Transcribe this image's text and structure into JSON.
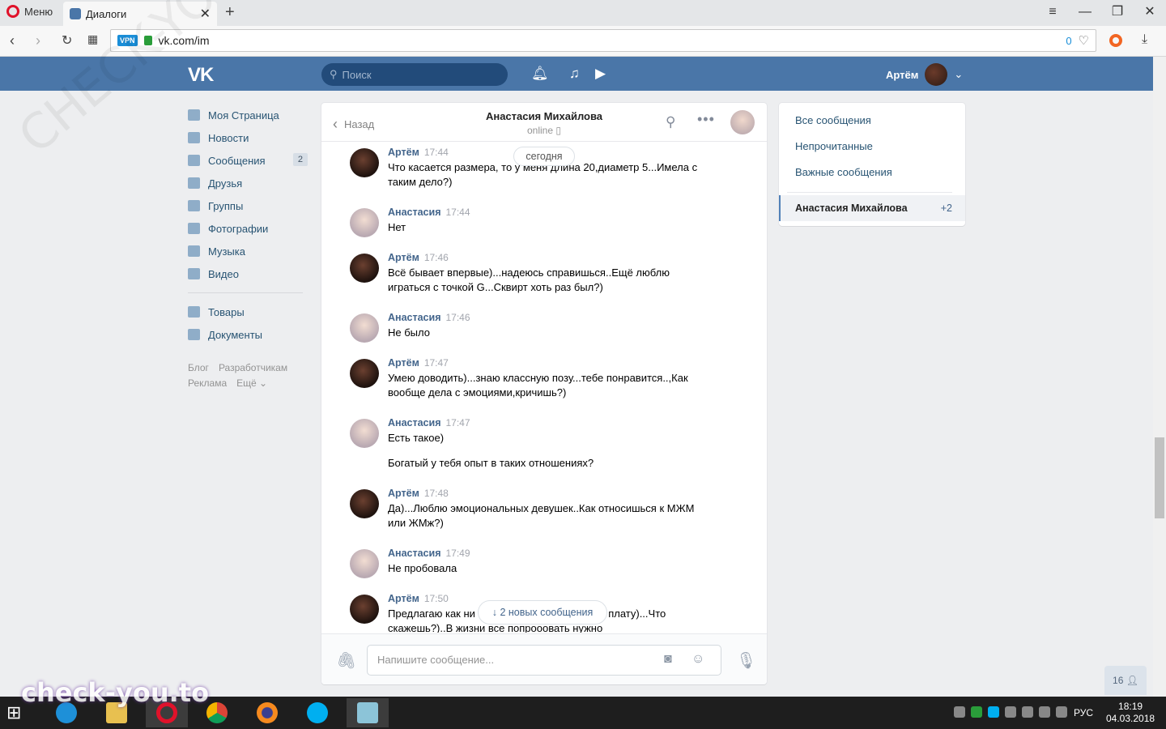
{
  "browser": {
    "menu_label": "Меню",
    "tab_title": "Диалоги",
    "url": "vk.com/im",
    "vpn": "VPN",
    "blocked_count": "0"
  },
  "vk": {
    "logo": "VK",
    "search_placeholder": "Поиск",
    "user_name": "Артём"
  },
  "left_menu": {
    "items": [
      {
        "label": "Моя Страница"
      },
      {
        "label": "Новости"
      },
      {
        "label": "Сообщения",
        "badge": "2"
      },
      {
        "label": "Друзья"
      },
      {
        "label": "Группы"
      },
      {
        "label": "Фотографии"
      },
      {
        "label": "Музыка"
      },
      {
        "label": "Видео"
      }
    ],
    "items2": [
      {
        "label": "Товары"
      },
      {
        "label": "Документы"
      }
    ],
    "footer": [
      "Блог",
      "Разработчикам",
      "Реклама",
      "Ещё ⌄"
    ]
  },
  "chat": {
    "back_label": "Назад",
    "peer_name": "Анастасия Михайлова",
    "peer_status": "online",
    "day_divider": "сегодня",
    "new_messages": "2 новых сообщения",
    "input_placeholder": "Напишите сообщение...",
    "messages": [
      {
        "author": "Артём",
        "time": "17:44",
        "text": "Что касается размера, то у меня длина 20,диаметр 5...Имела с таким дело?)"
      },
      {
        "author": "Анастасия",
        "time": "17:44",
        "text": "Нет"
      },
      {
        "author": "Артём",
        "time": "17:46",
        "text": "Всё бывает впервые)...надеюсь справишься..Ещё люблю играться с точкой G...Сквирт хоть раз был?)"
      },
      {
        "author": "Анастасия",
        "time": "17:46",
        "text": "Не было"
      },
      {
        "author": "Артём",
        "time": "17:47",
        "text": "Умею доводить)...знаю классную позу...тебе понравится..,Как вообще дела с эмоциями,кричишь?)"
      },
      {
        "author": "Анастасия",
        "time": "17:47",
        "text": "Есть такое)",
        "extra": "Богатый у тебя опыт в таких отношениях?"
      },
      {
        "author": "Артём",
        "time": "17:48",
        "text": "Да)...Люблю эмоциональных девушек..Как относишься к МЖМ или ЖМж?)"
      },
      {
        "author": "Анастасия",
        "time": "17:49",
        "text": "Не пробовала"
      },
      {
        "author": "Артём",
        "time": "17:50",
        "text": "Предлагаю как ни                                      ную плату)...Что скажешь?)..В жизни все попрооовать нужно"
      }
    ]
  },
  "right_panel": {
    "items": [
      "Все сообщения",
      "Непрочитанные",
      "Важные сообщения"
    ],
    "active_name": "Анастасия Михайлова",
    "active_count": "+2"
  },
  "online_count": "16",
  "taskbar": {
    "lang": "РУС",
    "time": "18:19",
    "date": "04.03.2018"
  },
  "watermark": "check-you.to",
  "watermark_diag": "CHECK-YOU.ME"
}
